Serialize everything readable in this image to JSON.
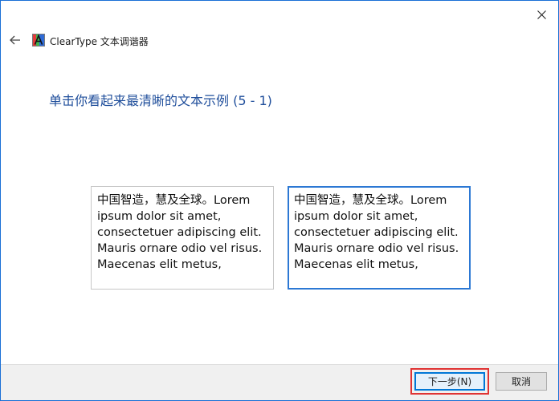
{
  "window": {
    "title": "ClearType 文本调谐器",
    "icons": {
      "app": "cleartype-app-icon",
      "back": "back-arrow-icon",
      "close": "close-icon"
    }
  },
  "main": {
    "instruction": "单击你看起来最清晰的文本示例 (5 - 1)",
    "samples": [
      {
        "lines": [
          "中国智造，慧及全球。Lorem",
          "ipsum dolor sit amet,",
          "consectetuer adipiscing elit.",
          "Mauris ornare odio vel risus.",
          "Maecenas elit metus,"
        ],
        "selected": false
      },
      {
        "lines": [
          "中国智造，慧及全球。Lorem",
          "ipsum dolor sit amet,",
          "consectetuer adipiscing elit.",
          "Mauris ornare odio vel risus.",
          "Maecenas elit metus,"
        ],
        "selected": true
      }
    ]
  },
  "footer": {
    "next_label": "下一步(N)",
    "cancel_label": "取消"
  },
  "colors": {
    "window_border": "#1a6fd6",
    "instruction_text": "#1f4e9b",
    "selected_sample_border": "#2c78d4",
    "highlight": "#e03434"
  }
}
